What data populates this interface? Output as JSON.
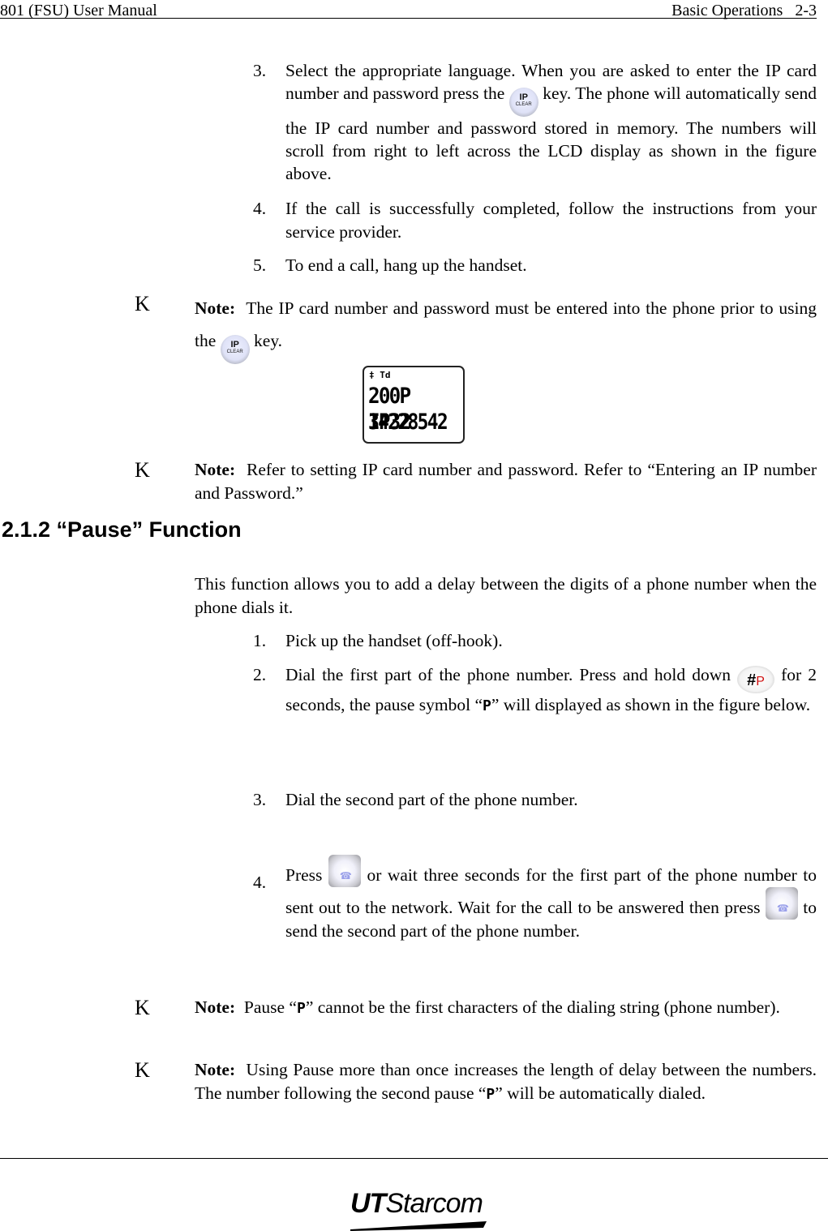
{
  "header": {
    "left": "801 (FSU) User Manual",
    "right": "Basic Operations   2-3"
  },
  "steps_a": [
    {
      "num": "3.",
      "before_key": "Select the appropriate language. When you are asked to enter the IP card number and password press the",
      "key": "ip-clear-key",
      "after_key": "key. The phone will automatically send the IP card number and password stored in memory. The numbers will scroll from right to left across the LCD display as shown in the figure above."
    },
    {
      "num": "4.",
      "text": "If the call is successfully completed, follow the instructions from your service provider."
    },
    {
      "num": "5.",
      "text": "To end a call, hang up the handset."
    }
  ],
  "note1": {
    "marker": "K",
    "label": "Note:",
    "before_key": "The IP card number and password must be entered into the phone prior to using the",
    "after_key": "key."
  },
  "ip_key": {
    "line1": "IP",
    "line2": "CLEAR"
  },
  "lcd": {
    "status": "‡ Td",
    "line1": "200P IP32",
    "line2": "34228542"
  },
  "note2": {
    "marker": "K",
    "label": "Note:",
    "text": "Refer to setting IP card number and password. Refer to “Entering an IP number and Password.”"
  },
  "section": {
    "title": "2.1.2 “Pause” Function"
  },
  "intro": "This function allows you to add a delay between the digits of a phone number when the phone dials it.",
  "steps_b": [
    {
      "num": "1.",
      "text": "Pick up the handset (off-hook)."
    },
    {
      "num": "2.",
      "before": "Dial the first part of the phone number. Press and hold down",
      "after": "for 2 seconds, the pause symbol “",
      "symbol": "P",
      "after2": "” will displayed as shown in the figure below."
    },
    {
      "num": "3.",
      "text": "Dial the second part of the phone number."
    },
    {
      "num": "4.",
      "p1": "Press",
      "p2": "or wait three seconds for the first part of the phone number to sent out to the network. Wait for the call to be answered then press",
      "p3": "to send the second part of the phone number."
    }
  ],
  "pause_key": {
    "hash": "#",
    "p": "P"
  },
  "send_key_glyph": "☎",
  "note3": {
    "marker": "K",
    "label": "Note:",
    "before": "Pause “",
    "symbol": "P",
    "after": "” cannot be the first characters of the dialing string (phone number)."
  },
  "note4": {
    "marker": "K",
    "label": "Note:",
    "before": "Using Pause more than once increases the length of delay between the numbers. The number following the second pause “",
    "symbol": "P",
    "after": "” will be automatically dialed."
  },
  "footer": {
    "logo_bold": "UT",
    "logo_rest": "Starcom"
  }
}
